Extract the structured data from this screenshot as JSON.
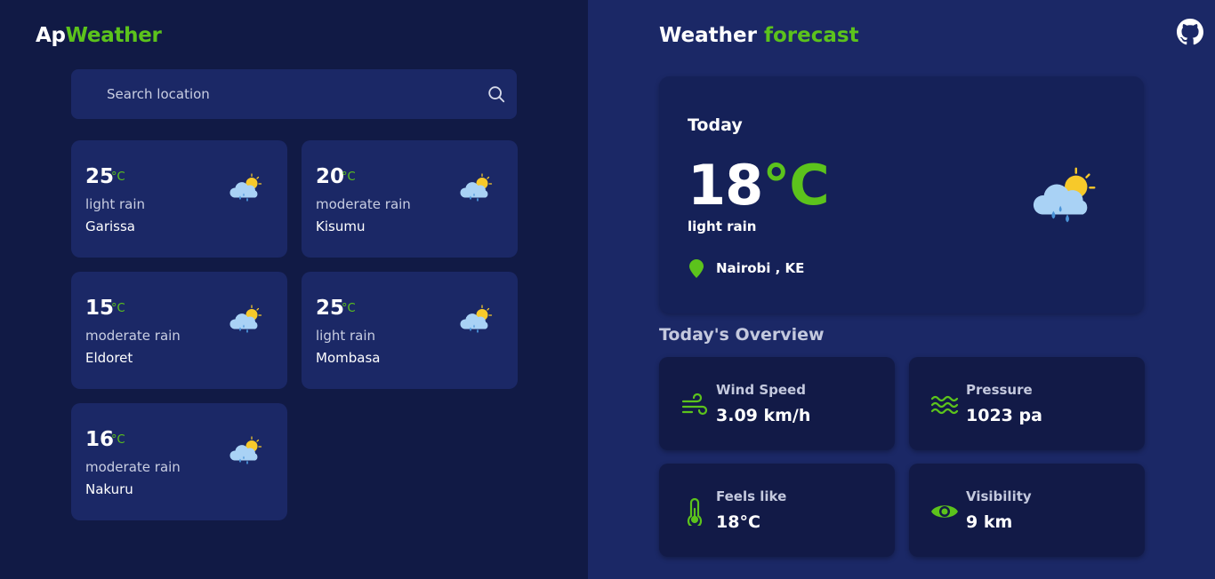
{
  "brand": {
    "part1": "Ap",
    "part2": "Weather"
  },
  "search": {
    "placeholder": "Search location"
  },
  "cities": [
    {
      "temp": "25",
      "unit": "°C",
      "desc": "light rain",
      "city": "Garissa"
    },
    {
      "temp": "20",
      "unit": "°C",
      "desc": "moderate rain",
      "city": "Kisumu"
    },
    {
      "temp": "15",
      "unit": "°C",
      "desc": "moderate rain",
      "city": "Eldoret"
    },
    {
      "temp": "25",
      "unit": "°C",
      "desc": "light rain",
      "city": "Mombasa"
    },
    {
      "temp": "16",
      "unit": "°C",
      "desc": "moderate rain",
      "city": "Nakuru"
    }
  ],
  "forecast": {
    "title_part1": "Weather",
    "title_part2": "forecast"
  },
  "today": {
    "label": "Today",
    "temp": "18",
    "unit": "°C",
    "desc": "light rain",
    "location": "Nairobi , KE",
    "icon": "cloud-sun-rain-icon"
  },
  "overview": {
    "title": "Today's Overview",
    "items": [
      {
        "label": "Wind Speed",
        "value": "3.09 km/h",
        "icon": "wind-icon"
      },
      {
        "label": "Pressure",
        "value": "1023 pa",
        "icon": "waves-icon"
      },
      {
        "label": "Feels like",
        "value": "18°C",
        "icon": "thermometer-icon"
      },
      {
        "label": "Visibility",
        "value": "9 km",
        "icon": "eye-icon"
      }
    ]
  },
  "colors": {
    "accent": "#5cc31c",
    "left_bg": "#111a45",
    "right_bg": "#1b2866",
    "card_bg": "#1b2866"
  }
}
